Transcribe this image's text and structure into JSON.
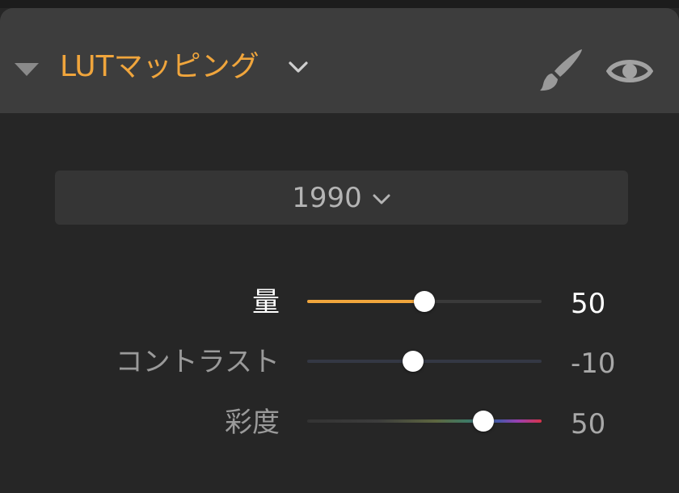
{
  "panel": {
    "title": "LUTマッピング",
    "collapse_icon": "triangle-down-icon",
    "title_menu_icon": "chevron-down-icon",
    "brush_icon": "paintbrush-icon",
    "eye_icon": "eye-icon",
    "accent_color": "#f0a53c"
  },
  "preset": {
    "selected": "1990",
    "icon": "chevron-down-icon"
  },
  "sliders": [
    {
      "label": "量",
      "value": "50",
      "fraction": 0.5,
      "active": true
    },
    {
      "label": "コントラスト",
      "value": "-10",
      "fraction": 0.45,
      "active": false
    },
    {
      "label": "彩度",
      "value": "50",
      "fraction": 0.75,
      "active": false,
      "track": "spectrum"
    }
  ]
}
